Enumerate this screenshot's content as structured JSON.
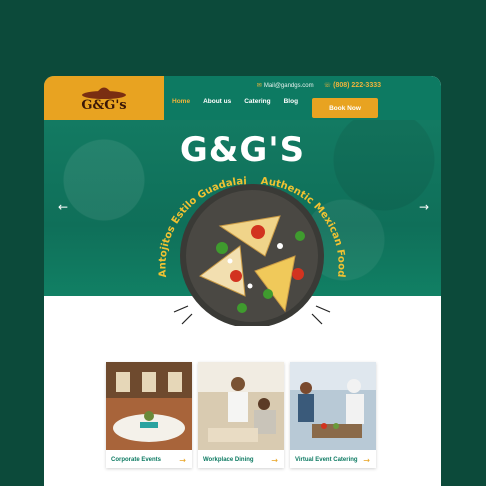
{
  "site": {
    "logo_text": "G&G's"
  },
  "contact": {
    "email": "Mail@gandgs.com",
    "phone": "(808) 222-3333"
  },
  "nav": {
    "items": [
      "Home",
      "About us",
      "Catering",
      "Blog"
    ],
    "book_label": "Book Now"
  },
  "hero": {
    "title": "G&G'S",
    "arc_left": "Antojitos Estilo Guadalajara",
    "arc_right": "Authentic Mexican Food"
  },
  "services": [
    {
      "label": "Corporate Events"
    },
    {
      "label": "Workplace Dining"
    },
    {
      "label": "Virtual Event Catering"
    }
  ],
  "colors": {
    "page_bg": "#0c4a3a",
    "brand_green": "#0d7a62",
    "brand_orange": "#e8a321",
    "accent_yellow": "#f1b43a"
  }
}
